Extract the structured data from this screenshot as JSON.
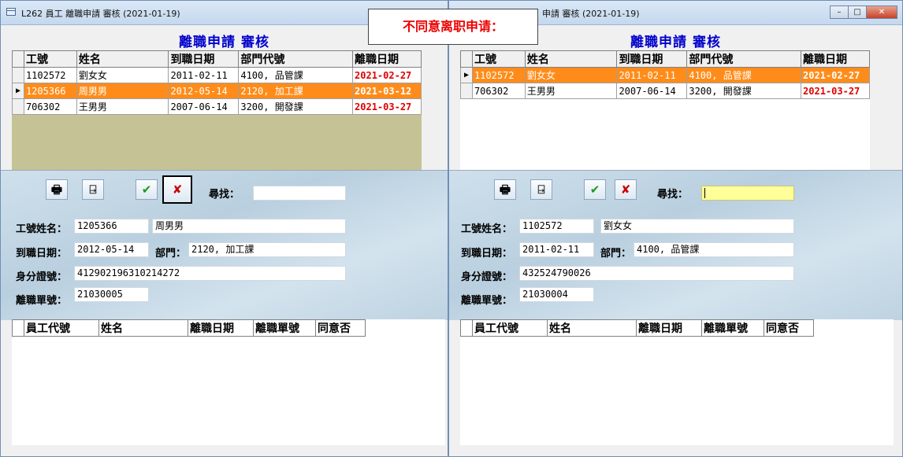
{
  "callout": {
    "text": "不同意离职申请："
  },
  "left": {
    "title": "L262 員工 離職申請 審核 (2021-01-19)",
    "page_title": "離職申請 審核",
    "columns": [
      "工號",
      "姓名",
      "到職日期",
      "部門代號",
      "離職日期"
    ],
    "rows": [
      {
        "id": "1102572",
        "name": "劉女女",
        "hire": "2011-02-11",
        "dept": "4100, 品管課",
        "leave": "2021-02-27"
      },
      {
        "id": "1205366",
        "name": "周男男",
        "hire": "2012-05-14",
        "dept": "2120, 加工課",
        "leave": "2021-03-12"
      },
      {
        "id": "706302",
        "name": "王男男",
        "hire": "2007-06-14",
        "dept": "3200, 開發課",
        "leave": "2021-03-27"
      }
    ],
    "selected_row_indicator": "▶",
    "toolbar": {
      "print_icon": "print-icon",
      "exit_icon": "exit-icon",
      "approve_icon": "check-icon",
      "reject_icon": "reject-x-icon",
      "approve_glyph": "✔",
      "reject_glyph": "✘",
      "print_glyph": "🖶",
      "exit_glyph": "⍈"
    },
    "search": {
      "label": "尋找：",
      "value": ""
    },
    "form": {
      "emp_label": "工號姓名：",
      "emp_id": "1205366",
      "emp_name": "周男男",
      "hire_label": "到職日期：",
      "hire_date": "2012-05-14",
      "dept_label": "部門：",
      "dept_value": "2120, 加工課",
      "idcard_label": "身分證號：",
      "idcard_value": "412902196310214272",
      "resign_label": "離職單號：",
      "resign_value": "21030005"
    },
    "history_columns": [
      "員工代號",
      "姓名",
      "離職日期",
      "離職單號",
      "同意否"
    ]
  },
  "right": {
    "title": "申請 審核 (2021-01-19)",
    "page_title": "離職申請 審核",
    "columns": [
      "工號",
      "姓名",
      "到職日期",
      "部門代號",
      "離職日期"
    ],
    "rows": [
      {
        "id": "1102572",
        "name": "劉女女",
        "hire": "2011-02-11",
        "dept": "4100, 品管課",
        "leave": "2021-02-27"
      },
      {
        "id": "706302",
        "name": "王男男",
        "hire": "2007-06-14",
        "dept": "3200, 開發課",
        "leave": "2021-03-27"
      }
    ],
    "selected_row_indicator": "▶",
    "search": {
      "label": "尋找：",
      "value": ""
    },
    "form": {
      "emp_label": "工號姓名：",
      "emp_id": "1102572",
      "emp_name": "劉女女",
      "hire_label": "到職日期：",
      "hire_date": "2011-02-11",
      "dept_label": "部門：",
      "dept_value": "4100, 品管課",
      "idcard_label": "身分證號：",
      "idcard_value": "432524790026",
      "resign_label": "離職單號：",
      "resign_value": "21030004"
    },
    "history_columns": [
      "員工代號",
      "姓名",
      "離職日期",
      "離職單號",
      "同意否"
    ],
    "window_buttons": {
      "minimize": "–",
      "maximize": "□",
      "close": "✕"
    }
  }
}
